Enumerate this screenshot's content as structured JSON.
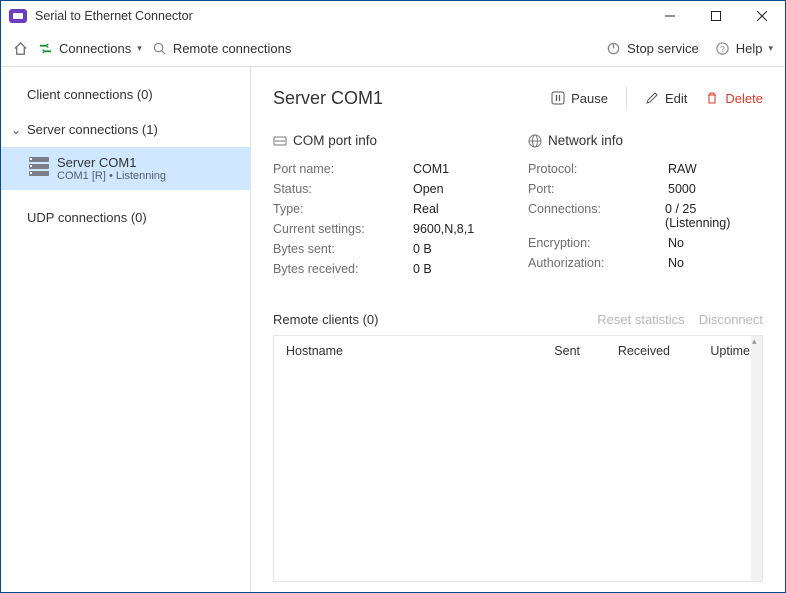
{
  "window": {
    "title": "Serial to Ethernet Connector"
  },
  "toolbar": {
    "connections": "Connections",
    "remote_connections": "Remote connections",
    "stop_service": "Stop service",
    "help": "Help"
  },
  "sidebar": {
    "client_heading": "Client connections (0)",
    "server_heading": "Server connections (1)",
    "server_item": {
      "title": "Server COM1",
      "subtitle": "COM1 [R] • Listenning"
    },
    "udp_heading": "UDP connections (0)"
  },
  "main": {
    "title": "Server COM1",
    "actions": {
      "pause": "Pause",
      "edit": "Edit",
      "delete": "Delete"
    },
    "com_port_heading": "COM port info",
    "network_heading": "Network info",
    "com": {
      "port_name_k": "Port name:",
      "port_name_v": "COM1",
      "status_k": "Status:",
      "status_v": "Open",
      "type_k": "Type:",
      "type_v": "Real",
      "settings_k": "Current settings:",
      "settings_v": "9600,N,8,1",
      "sent_k": "Bytes sent:",
      "sent_v": "0 B",
      "recv_k": "Bytes received:",
      "recv_v": "0 B"
    },
    "net": {
      "protocol_k": "Protocol:",
      "protocol_v": "RAW",
      "port_k": "Port:",
      "port_v": "5000",
      "conn_k": "Connections:",
      "conn_v": "0 / 25 (Listenning)",
      "enc_k": "Encryption:",
      "enc_v": "No",
      "auth_k": "Authorization:",
      "auth_v": "No"
    },
    "remote_heading": "Remote clients (0)",
    "reset_stats": "Reset statistics",
    "disconnect": "Disconnect",
    "cols": {
      "hostname": "Hostname",
      "sent": "Sent",
      "received": "Received",
      "uptime": "Uptime"
    }
  }
}
